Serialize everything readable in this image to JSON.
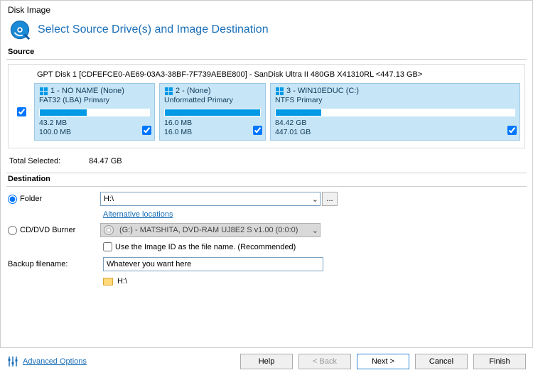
{
  "window": {
    "title": "Disk Image"
  },
  "header": {
    "title": "Select Source Drive(s) and Image Destination"
  },
  "source": {
    "label": "Source",
    "disk_line": "GPT Disk 1 [CDFEFCE0-AE69-03A3-38BF-7F739AEBE800] - SanDisk Ultra II 480GB X41310RL  <447.13 GB>",
    "master_checked": true,
    "partitions": [
      {
        "title": "1 - NO NAME (None)",
        "sub": "FAT32 (LBA) Primary",
        "used": "43.2 MB",
        "total": "100.0 MB",
        "fill_pct": 43,
        "checked": true
      },
      {
        "title": "2 -  (None)",
        "sub": "Unformatted Primary",
        "used": "16.0 MB",
        "total": "16.0 MB",
        "fill_pct": 100,
        "checked": true
      },
      {
        "title": "3 - WIN10EDUC (C:)",
        "sub": "NTFS Primary",
        "used": "84.42 GB",
        "total": "447.01 GB",
        "fill_pct": 19,
        "checked": true
      }
    ],
    "total_selected_label": "Total Selected:",
    "total_selected_value": "84.47 GB"
  },
  "destination": {
    "label": "Destination",
    "folder_radio_label": "Folder",
    "folder_selected": true,
    "folder_value": "H:\\",
    "browse_label": "...",
    "alt_locations_link": "Alternative locations",
    "burner_radio_label": "CD/DVD Burner",
    "burner_selected": false,
    "burner_value": "(G:) - MATSHITA, DVD-RAM UJ8E2 S  v1.00 (0:0:0)",
    "use_image_id_checked": false,
    "use_image_id_label": "Use the Image ID as the file name.  (Recommended)",
    "backup_filename_label": "Backup filename:",
    "backup_filename_value": "Whatever you want here",
    "hloc_label": "H:\\"
  },
  "footer": {
    "advanced_label": "Advanced Options",
    "buttons": {
      "help": "Help",
      "back": "< Back",
      "next": "Next >",
      "cancel": "Cancel",
      "finish": "Finish"
    }
  }
}
